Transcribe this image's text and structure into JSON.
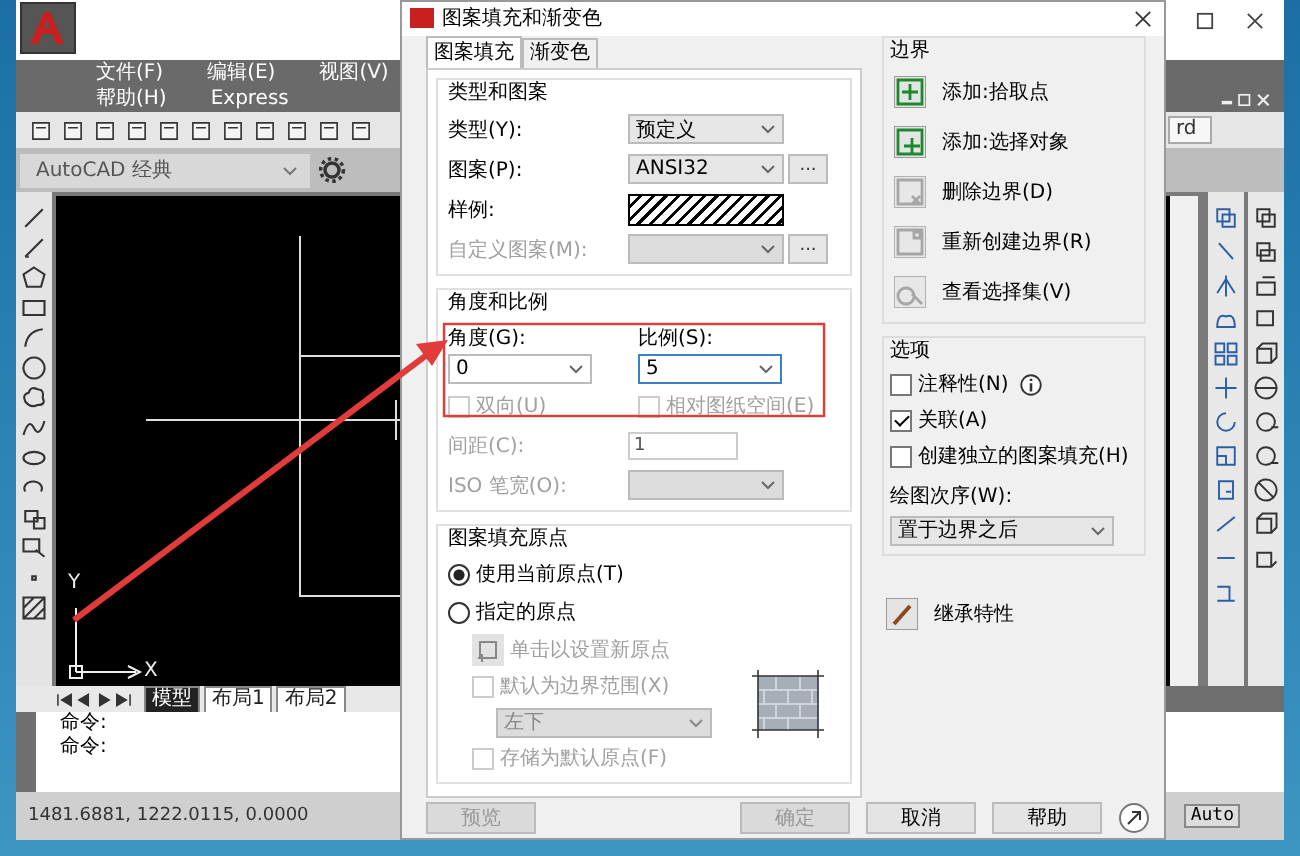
{
  "autocad": {
    "menu_row1": [
      "文件(F)",
      "编辑(E)",
      "视图(V)"
    ],
    "menu_row2": [
      "帮助(H)",
      "Express"
    ],
    "workspace": "AutoCAD 经典",
    "style_field": "rd",
    "axis_labels": [
      "Y",
      "X"
    ],
    "layout_tabs": [
      {
        "label": "模型",
        "selected": true
      },
      {
        "label": "布局1",
        "selected": false
      },
      {
        "label": "布局2",
        "selected": false
      }
    ],
    "command_lines": [
      "命令:",
      "命令:"
    ],
    "coordinates": "1481.6881, 1222.0115, 0.0000",
    "annotation_scale": "Auto"
  },
  "dialog": {
    "title": "图案填充和渐变色",
    "tabs": [
      {
        "label": "图案填充",
        "selected": true
      },
      {
        "label": "渐变色",
        "selected": false
      }
    ],
    "type_pattern": {
      "title": "类型和图案",
      "rows": [
        {
          "kind": "select",
          "label": "类型(Y):",
          "value": "预定义",
          "disabled": false
        },
        {
          "kind": "select",
          "label": "图案(P):",
          "value": "ANSI32",
          "disabled": false,
          "browse": "..."
        },
        {
          "kind": "swatch",
          "label": "样例:",
          "disabled": false
        },
        {
          "kind": "select",
          "label": "自定义图案(M):",
          "disabled": true,
          "browse": "..."
        }
      ]
    },
    "angle_scale": {
      "title": "角度和比例",
      "angle": {
        "label": "角度(G):",
        "value": "0"
      },
      "scale": {
        "label": "比例(S):",
        "value": "5"
      },
      "checks": [
        {
          "label": "双向(U)",
          "checked": false,
          "disabled": true
        },
        {
          "label": "相对图纸空间(E)",
          "checked": false,
          "disabled": true
        }
      ],
      "spacing": {
        "label": "间距(C):",
        "value": "1",
        "disabled": true
      },
      "pen_width": {
        "label": "ISO 笔宽(O):",
        "disabled": true
      }
    },
    "origin": {
      "title": "图案填充原点",
      "radios": [
        {
          "label": "使用当前原点(T)",
          "selected": true
        },
        {
          "label": "指定的原点",
          "selected": false
        }
      ],
      "set_origin": {
        "label": "单击以设置新原点",
        "disabled": true
      },
      "default_extents": {
        "label": "默认为边界范围(X)",
        "checked": false,
        "disabled": true
      },
      "position": {
        "value": "左下",
        "disabled": true
      },
      "store_default": {
        "label": "存储为默认原点(F)",
        "checked": false,
        "disabled": true
      }
    },
    "boundary": {
      "title": "边界",
      "buttons": [
        {
          "label": "添加:拾取点",
          "disabled": false
        },
        {
          "label": "添加:选择对象",
          "disabled": false
        },
        {
          "label": "删除边界(D)",
          "disabled": true
        },
        {
          "label": "重新创建边界(R)",
          "disabled": true
        },
        {
          "label": "查看选择集(V)",
          "disabled": true
        }
      ]
    },
    "options": {
      "title": "选项",
      "checks": [
        {
          "label": "注释性(N)",
          "checked": false,
          "info": true
        },
        {
          "label": "关联(A)",
          "checked": true,
          "info": false
        },
        {
          "label": "创建独立的图案填充(H)",
          "checked": false,
          "info": false
        }
      ],
      "order_label": "绘图次序(W):",
      "order_value": "置于边界之后"
    },
    "inherit": "继承特性",
    "buttons": [
      {
        "label": "预览",
        "disabled": true
      },
      {
        "label": "确定",
        "disabled": true
      },
      {
        "label": "取消",
        "disabled": false
      },
      {
        "label": "帮助",
        "disabled": false
      }
    ]
  }
}
